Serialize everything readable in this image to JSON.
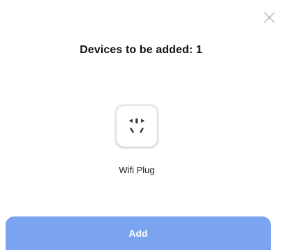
{
  "dialog": {
    "title": "Devices to be added: 1",
    "close_icon": "close-icon"
  },
  "devices": [
    {
      "label": "Wifi Plug",
      "icon": "smart-plug-icon"
    }
  ],
  "actions": {
    "add_label": "Add"
  },
  "colors": {
    "primary_button": "#7aa3f0",
    "button_text": "#ffffff",
    "close_icon": "#b8b8b8",
    "tile_background": "#eeeeee"
  }
}
